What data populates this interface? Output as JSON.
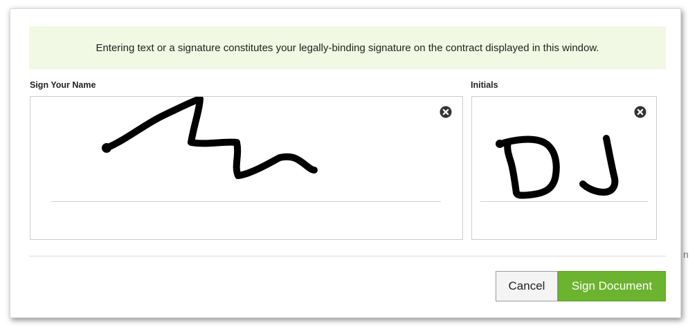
{
  "notice": {
    "text": "Entering text or a signature constitutes your legally-binding signature on the contract displayed in this window."
  },
  "signature": {
    "label": "Sign Your Name",
    "clear_icon": "clear-circle-x-icon"
  },
  "initials": {
    "label": "Initials",
    "value": "DJ",
    "clear_icon": "clear-circle-x-icon"
  },
  "background": {
    "peek_text": "n"
  },
  "actions": {
    "cancel_label": "Cancel",
    "sign_label": "Sign Document"
  },
  "colors": {
    "notice_bg": "#f1f8e3",
    "primary_button": "#6cb32f",
    "ink": "#000000"
  }
}
